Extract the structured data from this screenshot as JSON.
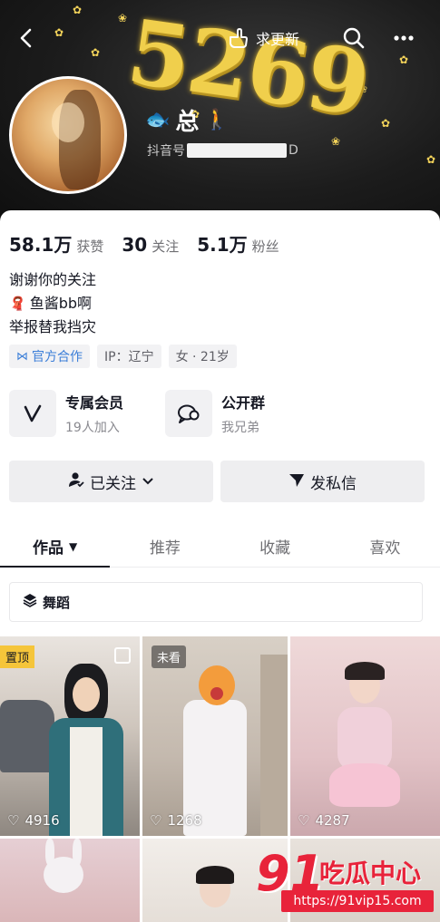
{
  "header": {
    "banner_number": "5269",
    "update_label": "求更新",
    "name": "总",
    "id_prefix": "抖音号",
    "id_suffix": "D"
  },
  "stats": [
    {
      "value": "58.1万",
      "label": "获赞"
    },
    {
      "value": "30",
      "label": "关注"
    },
    {
      "value": "5.1万",
      "label": "粉丝"
    }
  ],
  "bio": {
    "line1": "谢谢你的关注",
    "line2": "鱼酱bb啊",
    "line3": "举报替我挡灾"
  },
  "tags": {
    "official": "官方合作",
    "ip": "IP：辽宁",
    "gender_age": "女 · 21岁"
  },
  "cards": {
    "member_title": "专属会员",
    "member_sub": "19人加入",
    "group_title": "公开群",
    "group_sub": "我兄弟"
  },
  "actions": {
    "followed": "已关注",
    "message": "发私信"
  },
  "tabs": [
    "作品",
    "推荐",
    "收藏",
    "喜欢"
  ],
  "filter": {
    "label": "舞蹈"
  },
  "videos": [
    {
      "badge": "置顶",
      "likes": "4916"
    },
    {
      "badge": "未看",
      "likes": "1268"
    },
    {
      "badge": "",
      "likes": "4287"
    }
  ],
  "watermark": {
    "number": "91",
    "text": "吃瓜中心",
    "url": "https://91vip15.com"
  },
  "colors": {
    "accent_red": "#e8233a",
    "pin_yellow": "#f5c53a",
    "official_blue": "#3b7ed8"
  },
  "icons": [
    "back-icon",
    "hand-point-icon",
    "search-icon",
    "more-icon",
    "fish-icon",
    "walker-icon",
    "scarf-icon",
    "handshake-icon",
    "v-icon",
    "chat-icon",
    "person-check-icon",
    "chevron-down-icon",
    "send-icon",
    "caret-down-icon",
    "layers-icon",
    "heart-icon",
    "multi-image-icon"
  ]
}
